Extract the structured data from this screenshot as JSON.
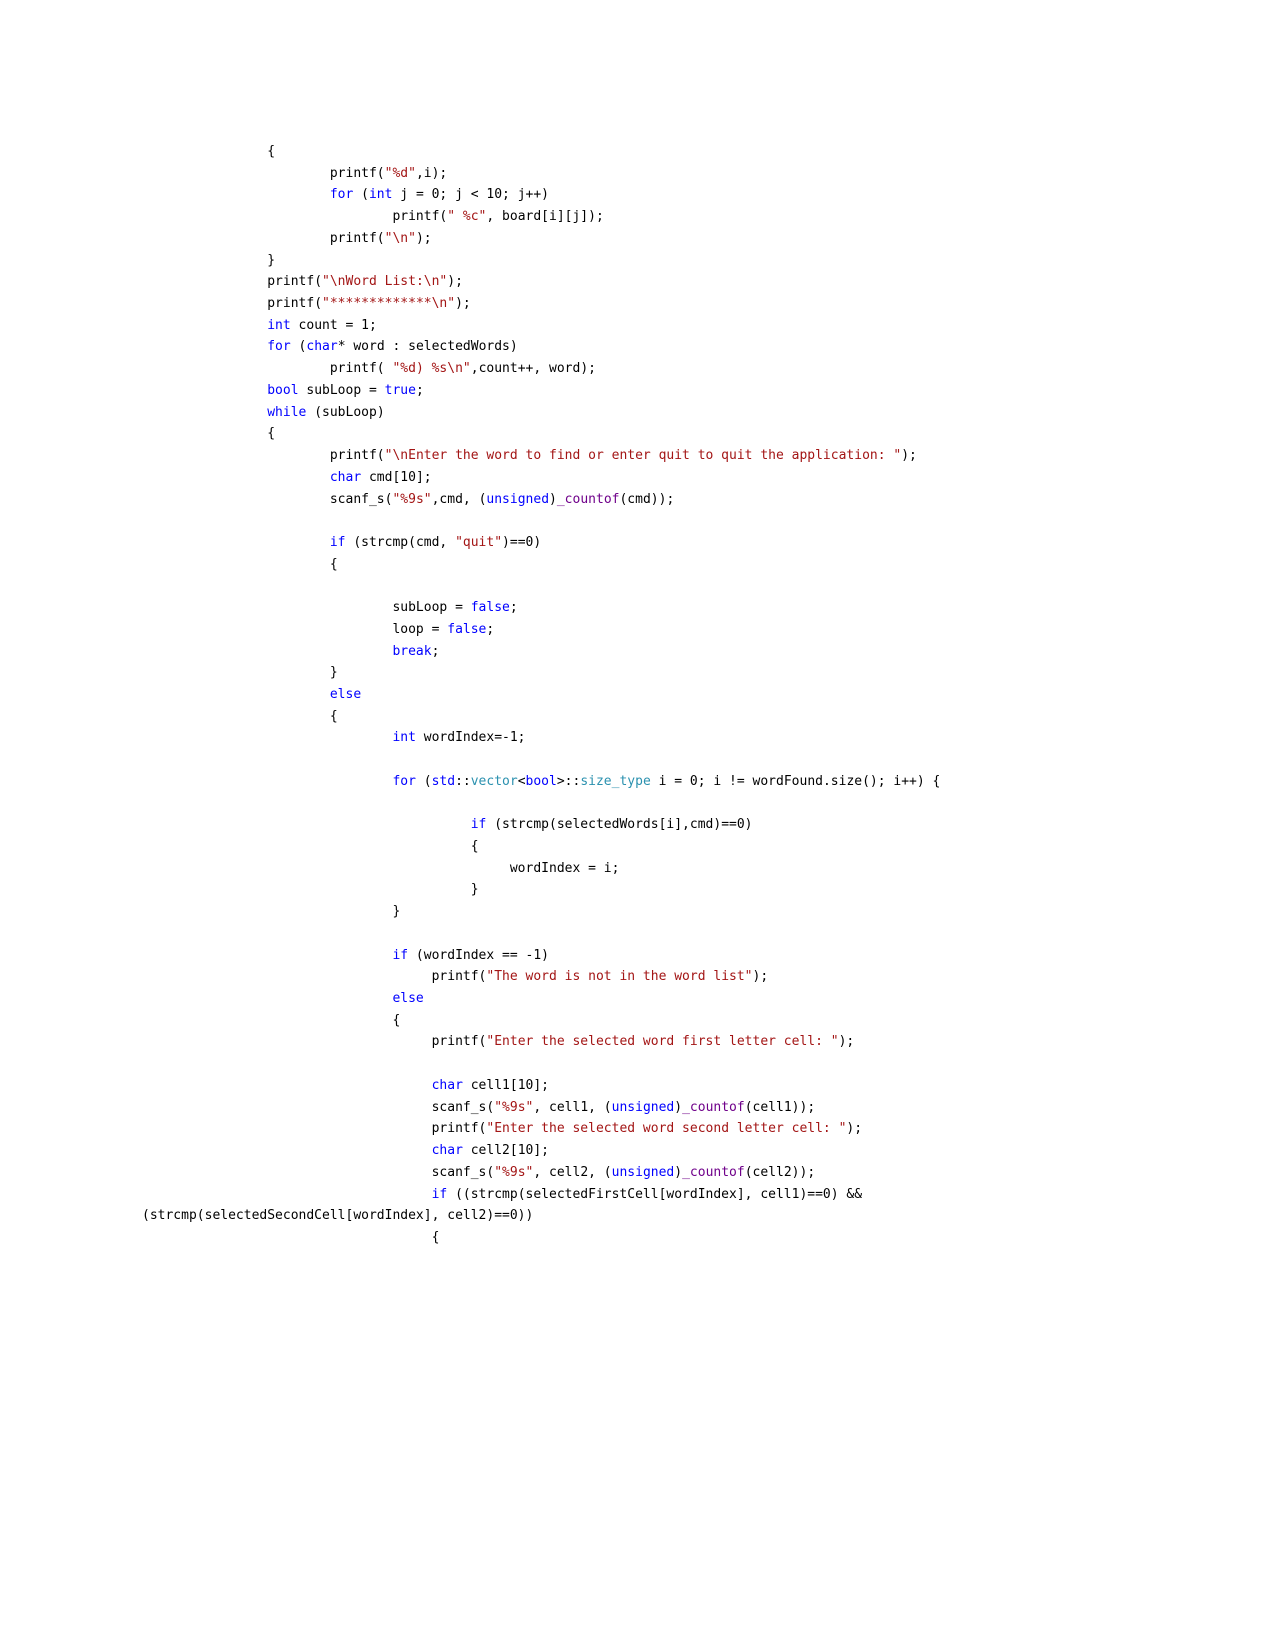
{
  "document": {
    "kind": "code-listing",
    "language": "C++",
    "page_background": "#ffffff",
    "text_color": "#000000"
  },
  "theme": {
    "keyword_color": "#0000ff",
    "string_color": "#a31515",
    "type_color": "#2b91af",
    "macro_color": "#6f008a",
    "plain_color": "#000000"
  },
  "code": {
    "lines": [
      {
        "id": "l01",
        "indent": 16,
        "tokens": [
          {
            "t": "{",
            "c": "pln"
          }
        ]
      },
      {
        "id": "l02",
        "indent": 24,
        "tokens": [
          {
            "t": "printf(",
            "c": "pln"
          },
          {
            "t": "\"%d\"",
            "c": "str"
          },
          {
            "t": ",i);",
            "c": "pln"
          }
        ]
      },
      {
        "id": "l03",
        "indent": 24,
        "tokens": [
          {
            "t": "for",
            "c": "kw"
          },
          {
            "t": " (",
            "c": "pln"
          },
          {
            "t": "int",
            "c": "kw"
          },
          {
            "t": " j = 0; j < 10; j++)",
            "c": "pln"
          }
        ]
      },
      {
        "id": "l04",
        "indent": 32,
        "tokens": [
          {
            "t": "printf(",
            "c": "pln"
          },
          {
            "t": "\" %c\"",
            "c": "str"
          },
          {
            "t": ", board[i][j]);",
            "c": "pln"
          }
        ]
      },
      {
        "id": "l05",
        "indent": 24,
        "tokens": [
          {
            "t": "printf(",
            "c": "pln"
          },
          {
            "t": "\"\\n\"",
            "c": "str"
          },
          {
            "t": ");",
            "c": "pln"
          }
        ]
      },
      {
        "id": "l06",
        "indent": 16,
        "tokens": [
          {
            "t": "}",
            "c": "pln"
          }
        ]
      },
      {
        "id": "l07",
        "indent": 16,
        "tokens": [
          {
            "t": "printf(",
            "c": "pln"
          },
          {
            "t": "\"\\nWord List:\\n\"",
            "c": "str"
          },
          {
            "t": ");",
            "c": "pln"
          }
        ]
      },
      {
        "id": "l08",
        "indent": 16,
        "tokens": [
          {
            "t": "printf(",
            "c": "pln"
          },
          {
            "t": "\"*************\\n\"",
            "c": "str"
          },
          {
            "t": ");",
            "c": "pln"
          }
        ]
      },
      {
        "id": "l09",
        "indent": 16,
        "tokens": [
          {
            "t": "int",
            "c": "kw"
          },
          {
            "t": " count = 1;",
            "c": "pln"
          }
        ]
      },
      {
        "id": "l10",
        "indent": 16,
        "tokens": [
          {
            "t": "for",
            "c": "kw"
          },
          {
            "t": " (",
            "c": "pln"
          },
          {
            "t": "char",
            "c": "kw"
          },
          {
            "t": "* word : selectedWords)",
            "c": "pln"
          }
        ]
      },
      {
        "id": "l11",
        "indent": 24,
        "tokens": [
          {
            "t": "printf( ",
            "c": "pln"
          },
          {
            "t": "\"%d) %s\\n\"",
            "c": "str"
          },
          {
            "t": ",count++, word);",
            "c": "pln"
          }
        ]
      },
      {
        "id": "l12",
        "indent": 16,
        "tokens": [
          {
            "t": "bool",
            "c": "kw"
          },
          {
            "t": " subLoop = ",
            "c": "pln"
          },
          {
            "t": "true",
            "c": "kw"
          },
          {
            "t": ";",
            "c": "pln"
          }
        ]
      },
      {
        "id": "l13",
        "indent": 16,
        "tokens": [
          {
            "t": "while",
            "c": "kw"
          },
          {
            "t": " (subLoop)",
            "c": "pln"
          }
        ]
      },
      {
        "id": "l14",
        "indent": 16,
        "tokens": [
          {
            "t": "{",
            "c": "pln"
          }
        ]
      },
      {
        "id": "l15",
        "indent": 24,
        "tokens": [
          {
            "t": "printf(",
            "c": "pln"
          },
          {
            "t": "\"\\nEnter the word to find or enter quit to quit the application: \"",
            "c": "str"
          },
          {
            "t": ");",
            "c": "pln"
          }
        ]
      },
      {
        "id": "l16",
        "indent": 24,
        "tokens": [
          {
            "t": "char",
            "c": "kw"
          },
          {
            "t": " cmd[10];",
            "c": "pln"
          }
        ]
      },
      {
        "id": "l17",
        "indent": 24,
        "tokens": [
          {
            "t": "scanf_s(",
            "c": "pln"
          },
          {
            "t": "\"%9s\"",
            "c": "str"
          },
          {
            "t": ",cmd, (",
            "c": "pln"
          },
          {
            "t": "unsigned",
            "c": "kw"
          },
          {
            "t": ")",
            "c": "pln"
          },
          {
            "t": "_countof",
            "c": "mac"
          },
          {
            "t": "(cmd));",
            "c": "pln"
          }
        ]
      },
      {
        "id": "l18",
        "indent": 24,
        "tokens": []
      },
      {
        "id": "l19",
        "indent": 24,
        "tokens": [
          {
            "t": "if",
            "c": "kw"
          },
          {
            "t": " (strcmp(cmd, ",
            "c": "pln"
          },
          {
            "t": "\"quit\"",
            "c": "str"
          },
          {
            "t": ")==0)",
            "c": "pln"
          }
        ]
      },
      {
        "id": "l20",
        "indent": 24,
        "tokens": [
          {
            "t": "{",
            "c": "pln"
          }
        ]
      },
      {
        "id": "l21",
        "indent": 24,
        "tokens": []
      },
      {
        "id": "l22",
        "indent": 32,
        "tokens": [
          {
            "t": "subLoop = ",
            "c": "pln"
          },
          {
            "t": "false",
            "c": "kw"
          },
          {
            "t": ";",
            "c": "pln"
          }
        ]
      },
      {
        "id": "l23",
        "indent": 32,
        "tokens": [
          {
            "t": "loop = ",
            "c": "pln"
          },
          {
            "t": "false",
            "c": "kw"
          },
          {
            "t": ";",
            "c": "pln"
          }
        ]
      },
      {
        "id": "l24",
        "indent": 32,
        "tokens": [
          {
            "t": "break",
            "c": "kw"
          },
          {
            "t": ";",
            "c": "pln"
          }
        ]
      },
      {
        "id": "l25",
        "indent": 24,
        "tokens": [
          {
            "t": "}",
            "c": "pln"
          }
        ]
      },
      {
        "id": "l26",
        "indent": 24,
        "tokens": [
          {
            "t": "else",
            "c": "kw"
          }
        ]
      },
      {
        "id": "l27",
        "indent": 24,
        "tokens": [
          {
            "t": "{",
            "c": "pln"
          }
        ]
      },
      {
        "id": "l28",
        "indent": 32,
        "tokens": [
          {
            "t": "int",
            "c": "kw"
          },
          {
            "t": " wordIndex=-1;",
            "c": "pln"
          }
        ]
      },
      {
        "id": "l29",
        "indent": 32,
        "tokens": []
      },
      {
        "id": "l30",
        "indent": 32,
        "tokens": [
          {
            "t": "for",
            "c": "kw"
          },
          {
            "t": " (",
            "c": "pln"
          },
          {
            "t": "std",
            "c": "kw"
          },
          {
            "t": "::",
            "c": "pln"
          },
          {
            "t": "vector",
            "c": "typ"
          },
          {
            "t": "<",
            "c": "pln"
          },
          {
            "t": "bool",
            "c": "kw"
          },
          {
            "t": ">::",
            "c": "pln"
          },
          {
            "t": "size_type",
            "c": "typ"
          },
          {
            "t": " i = 0; i != wordFound.size(); i++) {",
            "c": "pln"
          }
        ]
      },
      {
        "id": "l31",
        "indent": 32,
        "tokens": []
      },
      {
        "id": "l32",
        "indent": 42,
        "tokens": [
          {
            "t": "if",
            "c": "kw"
          },
          {
            "t": " (strcmp(selectedWords[i],cmd)==0)",
            "c": "pln"
          }
        ]
      },
      {
        "id": "l33",
        "indent": 42,
        "tokens": [
          {
            "t": "{",
            "c": "pln"
          }
        ]
      },
      {
        "id": "l34",
        "indent": 47,
        "tokens": [
          {
            "t": "wordIndex = i;",
            "c": "pln"
          }
        ]
      },
      {
        "id": "l35",
        "indent": 42,
        "tokens": [
          {
            "t": "}",
            "c": "pln"
          }
        ]
      },
      {
        "id": "l36",
        "indent": 32,
        "tokens": [
          {
            "t": "}",
            "c": "pln"
          }
        ]
      },
      {
        "id": "l37",
        "indent": 32,
        "tokens": []
      },
      {
        "id": "l38",
        "indent": 32,
        "tokens": [
          {
            "t": "if",
            "c": "kw"
          },
          {
            "t": " (wordIndex == -1)",
            "c": "pln"
          }
        ]
      },
      {
        "id": "l39",
        "indent": 37,
        "tokens": [
          {
            "t": "printf(",
            "c": "pln"
          },
          {
            "t": "\"The word is not in the word list\"",
            "c": "str"
          },
          {
            "t": ");",
            "c": "pln"
          }
        ]
      },
      {
        "id": "l40",
        "indent": 32,
        "tokens": [
          {
            "t": "else",
            "c": "kw"
          }
        ]
      },
      {
        "id": "l41",
        "indent": 32,
        "tokens": [
          {
            "t": "{",
            "c": "pln"
          }
        ]
      },
      {
        "id": "l42",
        "indent": 37,
        "tokens": [
          {
            "t": "printf(",
            "c": "pln"
          },
          {
            "t": "\"Enter the selected word first letter cell: \"",
            "c": "str"
          },
          {
            "t": ");",
            "c": "pln"
          }
        ]
      },
      {
        "id": "l43",
        "indent": 37,
        "tokens": []
      },
      {
        "id": "l44",
        "indent": 37,
        "tokens": [
          {
            "t": "char",
            "c": "kw"
          },
          {
            "t": " cell1[10];",
            "c": "pln"
          }
        ]
      },
      {
        "id": "l45",
        "indent": 37,
        "tokens": [
          {
            "t": "scanf_s(",
            "c": "pln"
          },
          {
            "t": "\"%9s\"",
            "c": "str"
          },
          {
            "t": ", cell1, (",
            "c": "pln"
          },
          {
            "t": "unsigned",
            "c": "kw"
          },
          {
            "t": ")",
            "c": "pln"
          },
          {
            "t": "_countof",
            "c": "mac"
          },
          {
            "t": "(cell1));",
            "c": "pln"
          }
        ]
      },
      {
        "id": "l46",
        "indent": 37,
        "tokens": [
          {
            "t": "printf(",
            "c": "pln"
          },
          {
            "t": "\"Enter the selected word second letter cell: \"",
            "c": "str"
          },
          {
            "t": ");",
            "c": "pln"
          }
        ]
      },
      {
        "id": "l47",
        "indent": 37,
        "tokens": [
          {
            "t": "char",
            "c": "kw"
          },
          {
            "t": " cell2[10];",
            "c": "pln"
          }
        ]
      },
      {
        "id": "l48",
        "indent": 37,
        "tokens": [
          {
            "t": "scanf_s(",
            "c": "pln"
          },
          {
            "t": "\"%9s\"",
            "c": "str"
          },
          {
            "t": ", cell2, (",
            "c": "pln"
          },
          {
            "t": "unsigned",
            "c": "kw"
          },
          {
            "t": ")",
            "c": "pln"
          },
          {
            "t": "_countof",
            "c": "mac"
          },
          {
            "t": "(cell2));",
            "c": "pln"
          }
        ]
      },
      {
        "id": "l49",
        "indent": 37,
        "tokens": [
          {
            "t": "if",
            "c": "kw"
          },
          {
            "t": " ((strcmp(selectedFirstCell[wordIndex], cell1)==0) && (strcmp(selectedSecondCell[wordIndex], cell2)==0))",
            "c": "pln"
          }
        ]
      },
      {
        "id": "l50",
        "indent": 37,
        "tokens": [
          {
            "t": "{",
            "c": "pln"
          }
        ]
      }
    ]
  }
}
